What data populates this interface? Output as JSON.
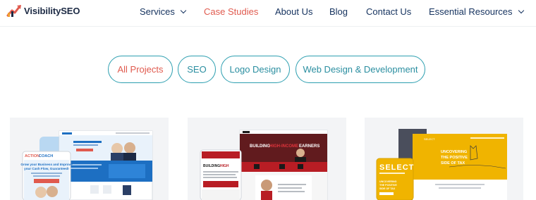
{
  "header": {
    "logo_text": "VisibilitySEO",
    "nav": [
      {
        "label": "Services",
        "has_dropdown": true,
        "active": false
      },
      {
        "label": "Case Studies",
        "has_dropdown": false,
        "active": true
      },
      {
        "label": "About Us",
        "has_dropdown": false,
        "active": false
      },
      {
        "label": "Blog",
        "has_dropdown": false,
        "active": false
      },
      {
        "label": "Contact Us",
        "has_dropdown": false,
        "active": false
      },
      {
        "label": "Essential Resources",
        "has_dropdown": true,
        "active": false
      }
    ]
  },
  "filters": [
    {
      "label": "All Projects",
      "active": true
    },
    {
      "label": "SEO",
      "active": false
    },
    {
      "label": "Logo Design",
      "active": false
    },
    {
      "label": "Web Design & Development",
      "active": false
    }
  ],
  "projects": [
    {
      "name": "ActionCOACH",
      "thumb_text": "ACTIONCOACH",
      "thumb_headline": "Grow your Business and Improve your Cash Flow, Guaranteed!",
      "accent": "#1d6fc2"
    },
    {
      "name": "Building High Income Earners",
      "thumb_text": "BUILDING HIGH-INCOME EARNERS",
      "accent": "#b81d24"
    },
    {
      "name": "Select",
      "thumb_text": "SELECT",
      "thumb_headline": "UNCOVERING THE POSITIVE SIDE OF TAX",
      "accent": "#f0b400"
    }
  ],
  "colors": {
    "brand_navy": "#173460",
    "accent_red": "#e05a4e",
    "pill_teal": "#2d9fb0",
    "card_bg": "#f3f4f6"
  }
}
